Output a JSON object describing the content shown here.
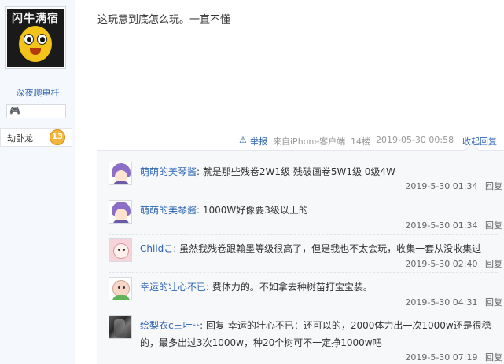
{
  "author": {
    "avatar_text": "闪牛满宿",
    "name": "深夜爬电杆",
    "level_title": "劫卧龙",
    "level_number": "13",
    "game_icon": "game-controller-icon"
  },
  "post": {
    "content": "这玩意到底怎么玩。一直不懂"
  },
  "tail": {
    "report": "举报",
    "source": "来自iPhone客户端",
    "floor": "14楼",
    "time": "2019-05-30 00:58",
    "collapse_reply": "收起回复"
  },
  "replies": [
    {
      "user": "萌萌的美琴酱",
      "text": "就是那些残卷2W1级 残破画卷5W1级 0级4W",
      "time": "2019-5-30 01:34",
      "reply_label": "回复",
      "avatar": "purple-hair-avatar"
    },
    {
      "user": "萌萌的美琴酱",
      "text": "1000W好像要3级以上的",
      "time": "2019-5-30 01:34",
      "reply_label": "回复",
      "avatar": "purple-hair-avatar"
    },
    {
      "user": "Childこ",
      "text": "虽然我残卷跟翰墨等级很高了，但是我也不太会玩，收集一套从没收集过",
      "time": "2019-5-30 02:40",
      "reply_label": "回复",
      "avatar": "pink-cartoon-avatar"
    },
    {
      "user": "幸运的壮心不已",
      "text": "费体力的。不如拿去种树苗打宝宝装。",
      "time": "2019-5-30 04:31",
      "reply_label": "回复",
      "avatar": "green-cartoon-avatar"
    },
    {
      "user": "绘梨衣c三叶",
      "user_suffix": "⁺⁺",
      "reply_prefix": "回复",
      "reply_target": "幸运的壮心不已",
      "text": "：还可以的，2000体力出一次1000w还是很稳的，最多出过3次1000w，种20个树可不一定挣1000w吧",
      "time": "2019-5-30 07:19",
      "reply_label": "回复",
      "avatar": "photo-avatar"
    }
  ],
  "colors": {
    "link": "#2d64b3",
    "reply_bg": "#f7f8fa",
    "sidebar_bg": "#f5f8fc",
    "level_badge": "#f4b63a"
  }
}
